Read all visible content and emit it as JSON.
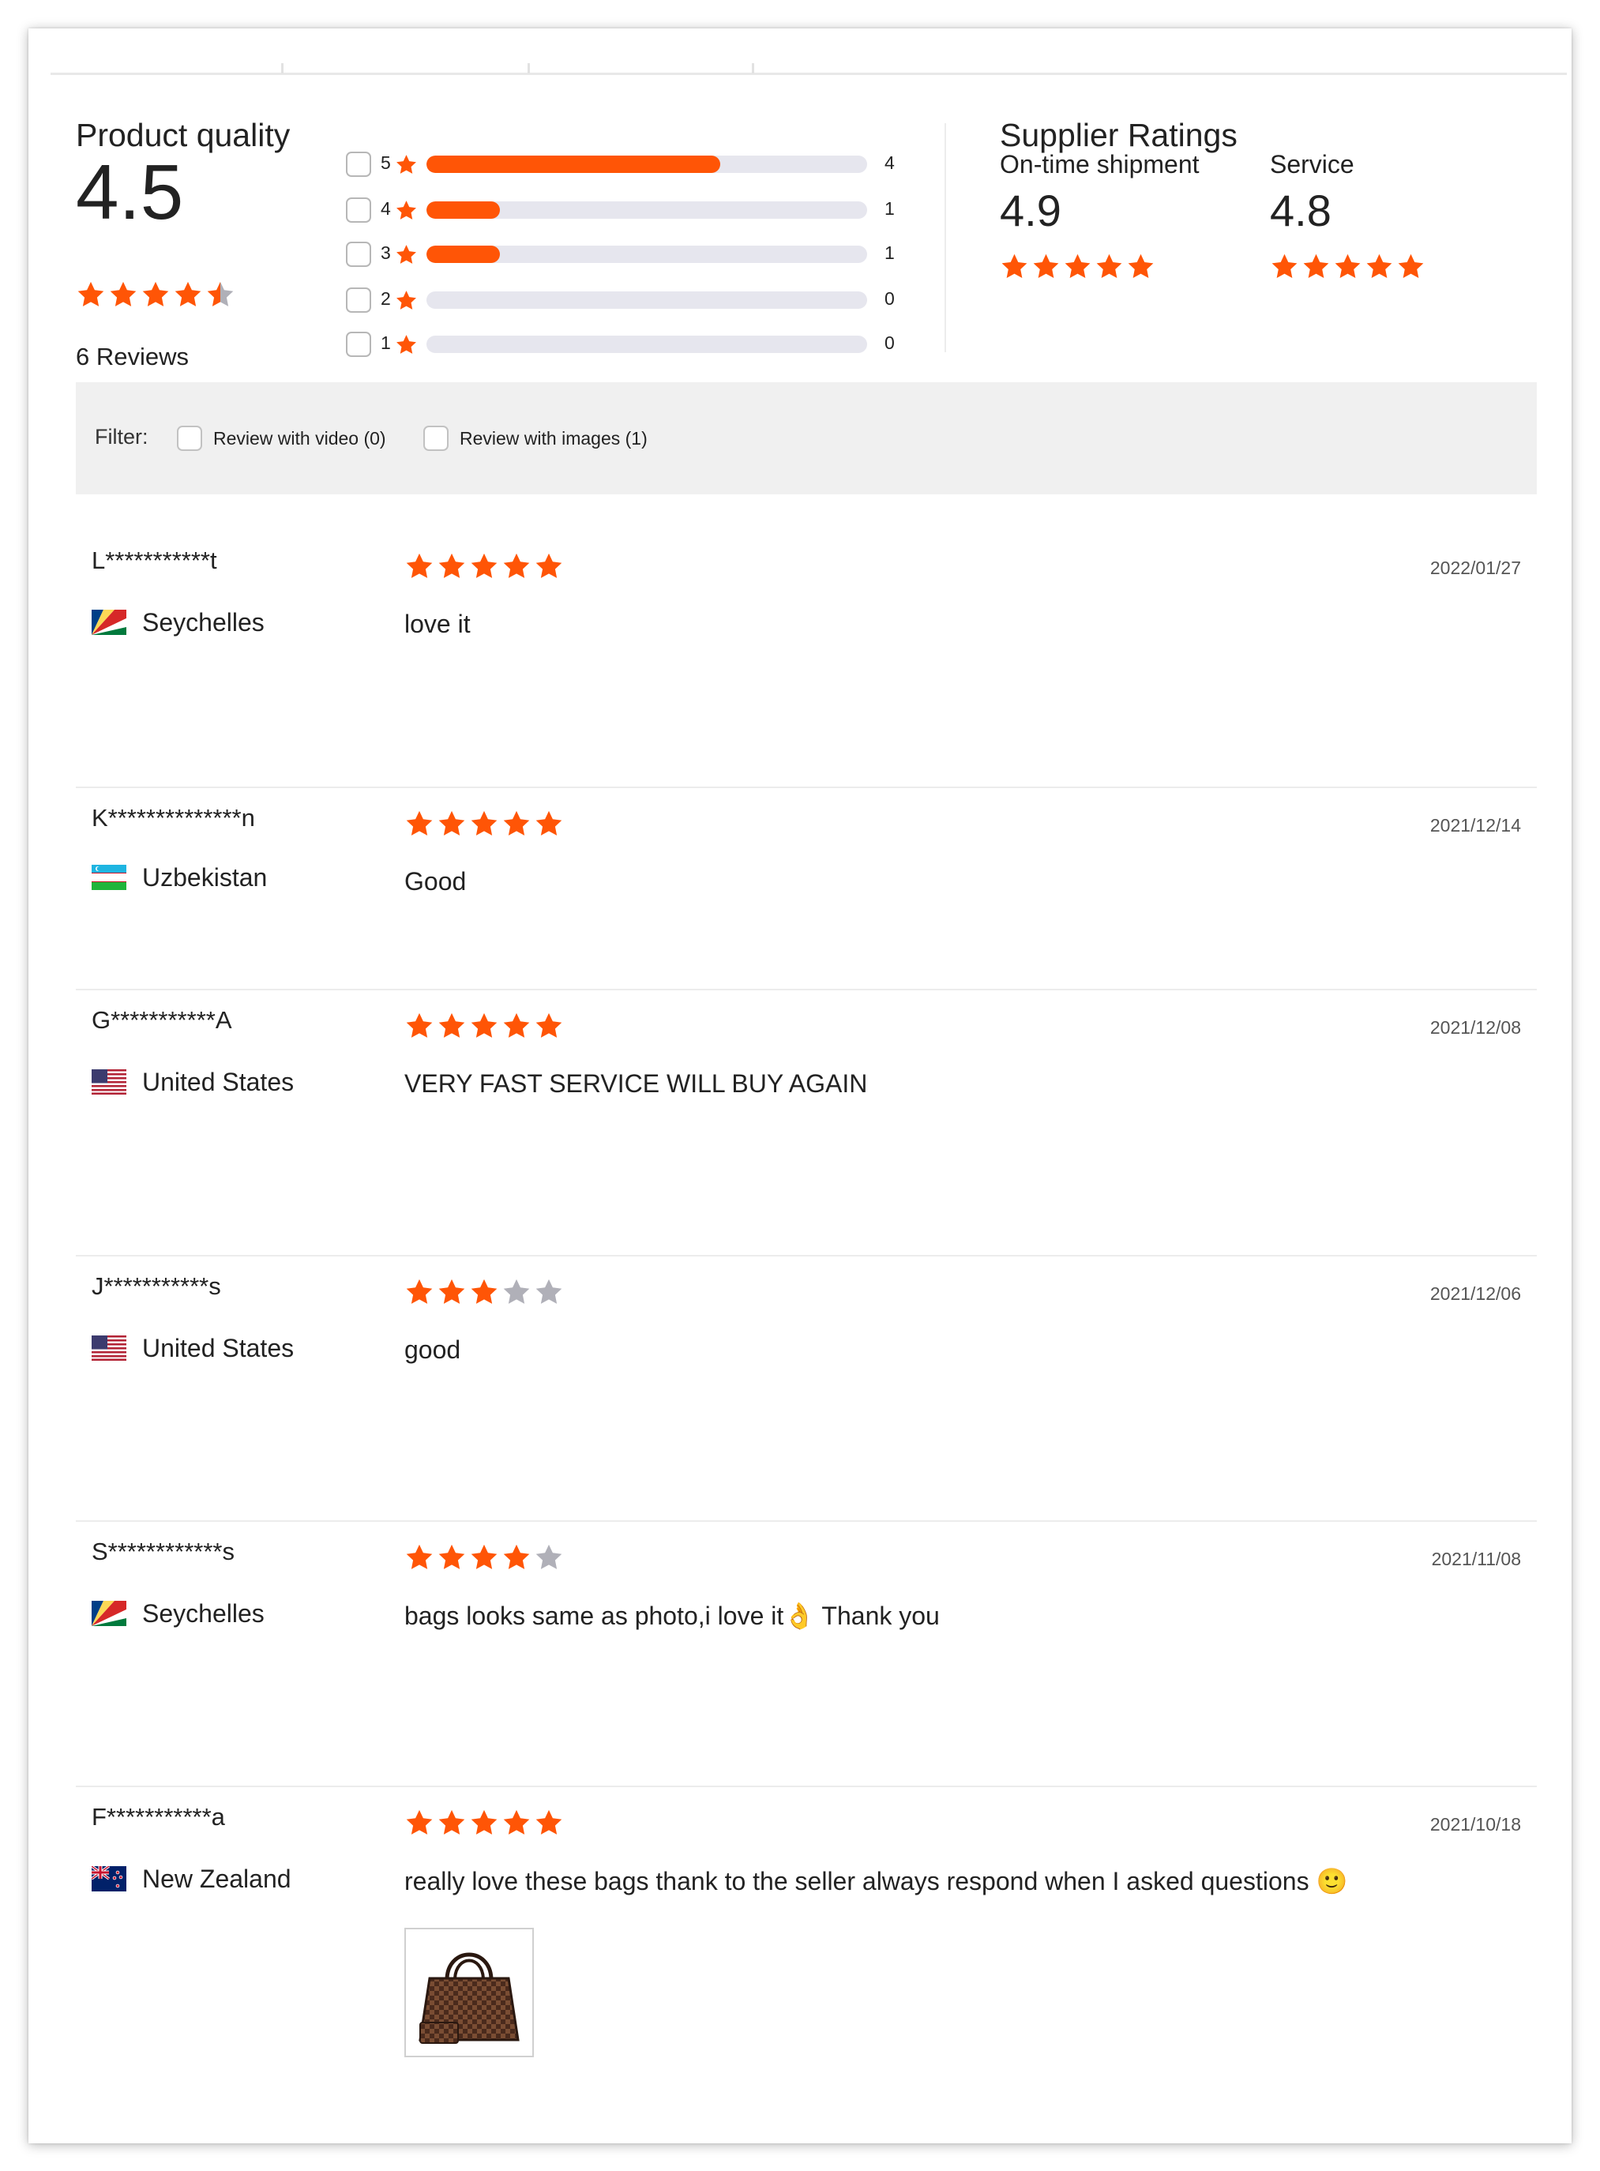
{
  "colors": {
    "accent": "#ff5506",
    "star_empty": "#b0b0b8",
    "track": "#e6e6ee"
  },
  "product_quality": {
    "title": "Product quality",
    "score": "4.5",
    "rating": 4.5,
    "reviews_label": "6 Reviews"
  },
  "distribution": [
    {
      "stars": "5",
      "count": "4",
      "fraction": 0.667
    },
    {
      "stars": "4",
      "count": "1",
      "fraction": 0.167
    },
    {
      "stars": "3",
      "count": "1",
      "fraction": 0.167
    },
    {
      "stars": "2",
      "count": "0",
      "fraction": 0
    },
    {
      "stars": "1",
      "count": "0",
      "fraction": 0
    }
  ],
  "supplier_ratings": {
    "title": "Supplier Ratings",
    "ontime": {
      "label": "On-time shipment",
      "value": "4.9",
      "rating": 5
    },
    "service": {
      "label": "Service",
      "value": "4.8",
      "rating": 5
    }
  },
  "filter": {
    "label": "Filter:",
    "video": "Review with video (0)",
    "images": "Review with images (1)"
  },
  "reviews": [
    {
      "name": "L***********t",
      "country": "Seychelles",
      "flag": "seychelles-flag-icon",
      "rating": 5,
      "date": "2022/01/27",
      "text": "love it"
    },
    {
      "name": "K**************n",
      "country": "Uzbekistan",
      "flag": "uzbekistan-flag-icon",
      "rating": 5,
      "date": "2021/12/14",
      "text": "Good"
    },
    {
      "name": "G***********A",
      "country": "United States",
      "flag": "us-flag-icon",
      "rating": 5,
      "date": "2021/12/08",
      "text": "VERY FAST SERVICE WILL BUY AGAIN"
    },
    {
      "name": "J***********s",
      "country": "United States",
      "flag": "us-flag-icon",
      "rating": 3,
      "date": "2021/12/06",
      "text": "good"
    },
    {
      "name": "S************s",
      "country": "Seychelles",
      "flag": "seychelles-flag-icon",
      "rating": 4,
      "date": "2021/11/08",
      "text": "bags looks same as photo,i love it👌 Thank you"
    },
    {
      "name": "F***********a",
      "country": "New Zealand",
      "flag": "new-zealand-flag-icon",
      "rating": 5,
      "date": "2021/10/18",
      "text": "really love these bags thank to the seller always respond when I asked questions 🙂",
      "image": "handbag-thumbnail"
    }
  ]
}
